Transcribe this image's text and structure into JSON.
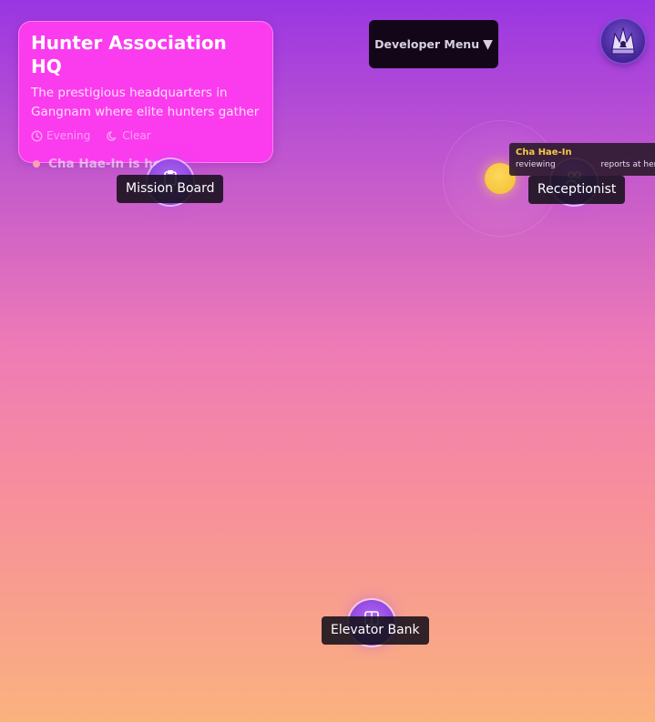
{
  "location": {
    "title": "Hunter Association HQ",
    "description": "The prestigious headquarters in Gangnam where elite hunters gather",
    "time_of_day": "Evening",
    "weather": "Clear",
    "presence": "Cha Hae-In is here",
    "time_icon": "clock-icon",
    "weather_icon": "moon-icon"
  },
  "header": {
    "dev_menu_label": "Developer Menu",
    "dev_menu_caret": "▼",
    "avatar_icon": "crown-crest-icon"
  },
  "hotspots": [
    {
      "label": "Mission Board",
      "icon": "clipboard-icon"
    },
    {
      "label": "Receptionist",
      "icon": "users-icon"
    },
    {
      "label": "Elevator Bank",
      "icon": "elevator-icon"
    }
  ],
  "character": {
    "name": "Cha Hae-In",
    "activity_before": "reviewing",
    "activity_after": "reports at her de"
  },
  "colors": {
    "card_background": "#fb3bee",
    "hotspot_purple": "#8e45e3",
    "character_gold": "#f5c63e",
    "gradient_top": "#9a36e2",
    "gradient_bottom": "#fab27e"
  }
}
